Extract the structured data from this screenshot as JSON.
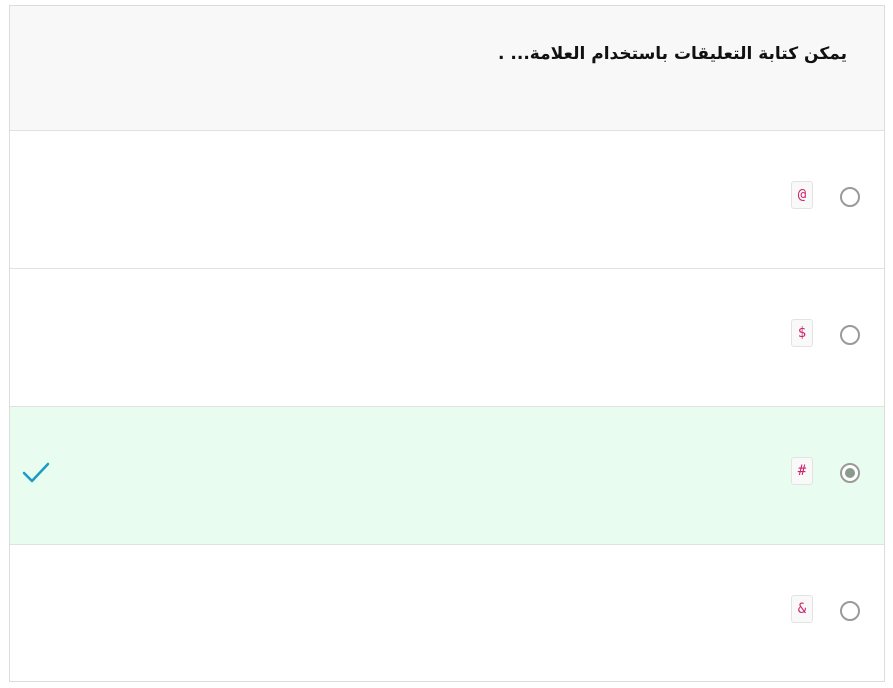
{
  "question": {
    "text": "يمكن كتابة التعليقات باستخدام العلامة... ."
  },
  "options": [
    {
      "symbol": "@",
      "selected": false,
      "correct": false
    },
    {
      "symbol": "$",
      "selected": false,
      "correct": false
    },
    {
      "symbol": "#",
      "selected": true,
      "correct": true
    },
    {
      "symbol": "&",
      "selected": false,
      "correct": false
    }
  ],
  "colors": {
    "correct_background": "#e8fdf0",
    "check_mark": "#1a9bc4",
    "code_text": "#d0216a"
  },
  "icons": {
    "correct_marker": "check-icon"
  }
}
